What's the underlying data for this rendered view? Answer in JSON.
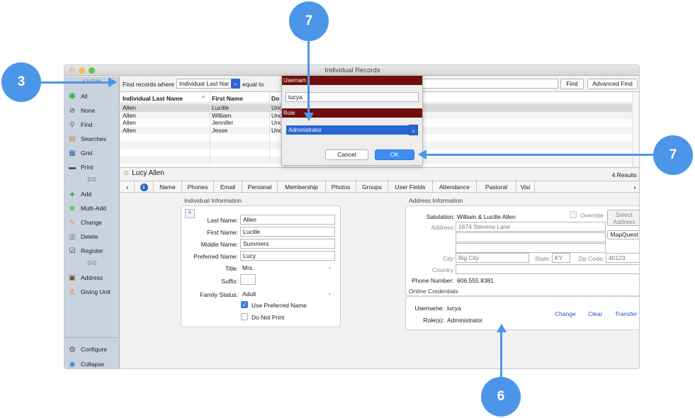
{
  "window": {
    "title": "Individual Records"
  },
  "sidebar": {
    "show_header": "SHOW",
    "show_items": [
      {
        "label": "All",
        "icon": "asterisk-icon"
      },
      {
        "label": "None",
        "icon": "no-entry-icon"
      },
      {
        "label": "Find",
        "icon": "magnifier-icon"
      },
      {
        "label": "Searches",
        "icon": "searches-icon"
      },
      {
        "label": "Grid",
        "icon": "grid-icon"
      },
      {
        "label": "Print",
        "icon": "printer-icon"
      }
    ],
    "do_header": "DO",
    "do_items": [
      {
        "label": "Add",
        "icon": "plus-icon"
      },
      {
        "label": "Multi-Add",
        "icon": "multi-add-icon"
      },
      {
        "label": "Change",
        "icon": "pencil-icon"
      },
      {
        "label": "Delete",
        "icon": "trash-icon"
      },
      {
        "label": "Register",
        "icon": "register-icon"
      }
    ],
    "go_header": "GO",
    "go_items": [
      {
        "label": "Address",
        "icon": "address-book-icon"
      },
      {
        "label": "Giving Unit",
        "icon": "giving-unit-icon"
      }
    ],
    "bottom_items": [
      {
        "label": "Configure",
        "icon": "gear-icon"
      },
      {
        "label": "Collapse",
        "icon": "collapse-icon"
      }
    ]
  },
  "findbar": {
    "prefix": "Find records where",
    "field": "Individual Last Nar",
    "operator": "equal to",
    "find_button": "Find",
    "advanced_button": "Advanced Find"
  },
  "table": {
    "columns": [
      "Individual Last Name",
      "First Name",
      "Do I"
    ],
    "sort_indicator": "^",
    "rows": [
      [
        "Allen",
        "Lucille",
        "Unc"
      ],
      [
        "Allen",
        "William",
        "Unc"
      ],
      [
        "Allen",
        "Jennifer",
        "Unc"
      ],
      [
        "Allen",
        "Jesse",
        "Unc"
      ]
    ]
  },
  "record": {
    "name": "Lucy Allen",
    "results": "4 Results",
    "tabs": [
      "Name",
      "Phones",
      "Email",
      "Personal",
      "Membership",
      "Photos",
      "Groups",
      "User Fields",
      "Attendance",
      "Pastoral",
      "Visi"
    ]
  },
  "individual_info": {
    "section_title": "Individual Information",
    "last_name_label": "Last Name:",
    "last_name": "Allen",
    "first_name_label": "First Name:",
    "first_name": "Lucille",
    "middle_name_label": "Middle Name:",
    "middle_name": "Summers",
    "preferred_name_label": "Preferred Name:",
    "preferred_name": "Lucy",
    "title_label": "Title:",
    "title": "Mrs.",
    "suffix_label": "Suffix:",
    "suffix": "",
    "family_status_label": "Family Status:",
    "family_status": "Adult",
    "use_preferred_label": "Use Preferred Name",
    "use_preferred_checked": true,
    "do_not_print_label": "Do Not Print",
    "do_not_print_checked": false
  },
  "address_info": {
    "section_title": "Address Information",
    "salutation_label": "Salutation:",
    "salutation": "William & Lucille Allen",
    "override_label": "Override",
    "select_address_button": "Select Address",
    "address_label": "Address:",
    "address_line1": "1674 Stevens Lane",
    "address_line2": "",
    "mapquest_button": "MapQuest",
    "city_label": "City:",
    "city": "Big City",
    "state_label": "State:",
    "state": "KY",
    "zip_label": "Zip Code:",
    "zip": "40123",
    "country_label": "Country:",
    "country": "",
    "phone_label": "Phone Number:",
    "phone": "606.555.8381"
  },
  "credentials": {
    "section_title": "Online Credentials",
    "username_label": "Username:",
    "username": "lucya",
    "roles_label": "Role(s):",
    "roles": "Administrator",
    "change_link": "Change",
    "clear_link": "Clear",
    "transfer_link": "Transfer"
  },
  "dialog": {
    "username_header": "Usernam",
    "username_value": "lucya",
    "role_header": "Role",
    "role_value": "Administrator",
    "cancel_button": "Cancel",
    "ok_button": "OK"
  },
  "callouts": {
    "left": "3",
    "top": "7",
    "right": "7",
    "bottom": "6"
  },
  "colors": {
    "accent": "#4c96e9",
    "dialog_header": "#6f0f0f",
    "selection": "#2a66d4",
    "link": "#1f56c9"
  }
}
